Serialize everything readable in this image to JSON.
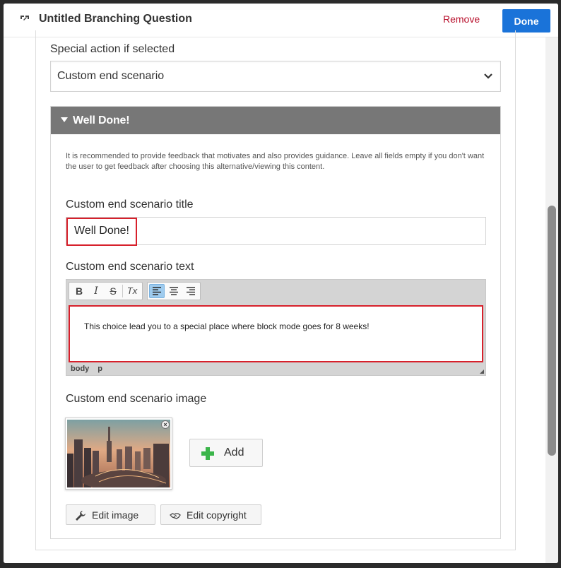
{
  "header": {
    "title": "Untitled Branching Question",
    "remove_label": "Remove",
    "done_label": "Done",
    "icon": "branching-icon"
  },
  "special_action": {
    "label": "Special action if selected",
    "selected": "Custom end scenario"
  },
  "feedback_panel": {
    "title": "Well Done!",
    "description": "It is recommended to provide feedback that motivates and also provides guidance. Leave all fields empty if you don't want the user to get feedback after choosing this alternative/viewing this content.",
    "title_field": {
      "label": "Custom end scenario title",
      "value": "Well Done!"
    },
    "text_field": {
      "label": "Custom end scenario text",
      "value": "This choice lead you to a special place where block mode goes for 8 weeks!",
      "toolbar": {
        "bold": "B",
        "italic": "I",
        "strike": "S",
        "clear": "Tx"
      },
      "status_path": [
        "body",
        "p"
      ]
    },
    "image_field": {
      "label": "Custom end scenario image",
      "remove_icon": "close-icon",
      "add_label": "Add",
      "edit_image_label": "Edit image",
      "edit_copyright_label": "Edit copyright"
    }
  },
  "colors": {
    "done_button": "#1a73d9",
    "remove_text": "#b8102c",
    "panel_header": "#777777",
    "highlight": "#d7202b",
    "add_plus": "#3bb54a"
  }
}
